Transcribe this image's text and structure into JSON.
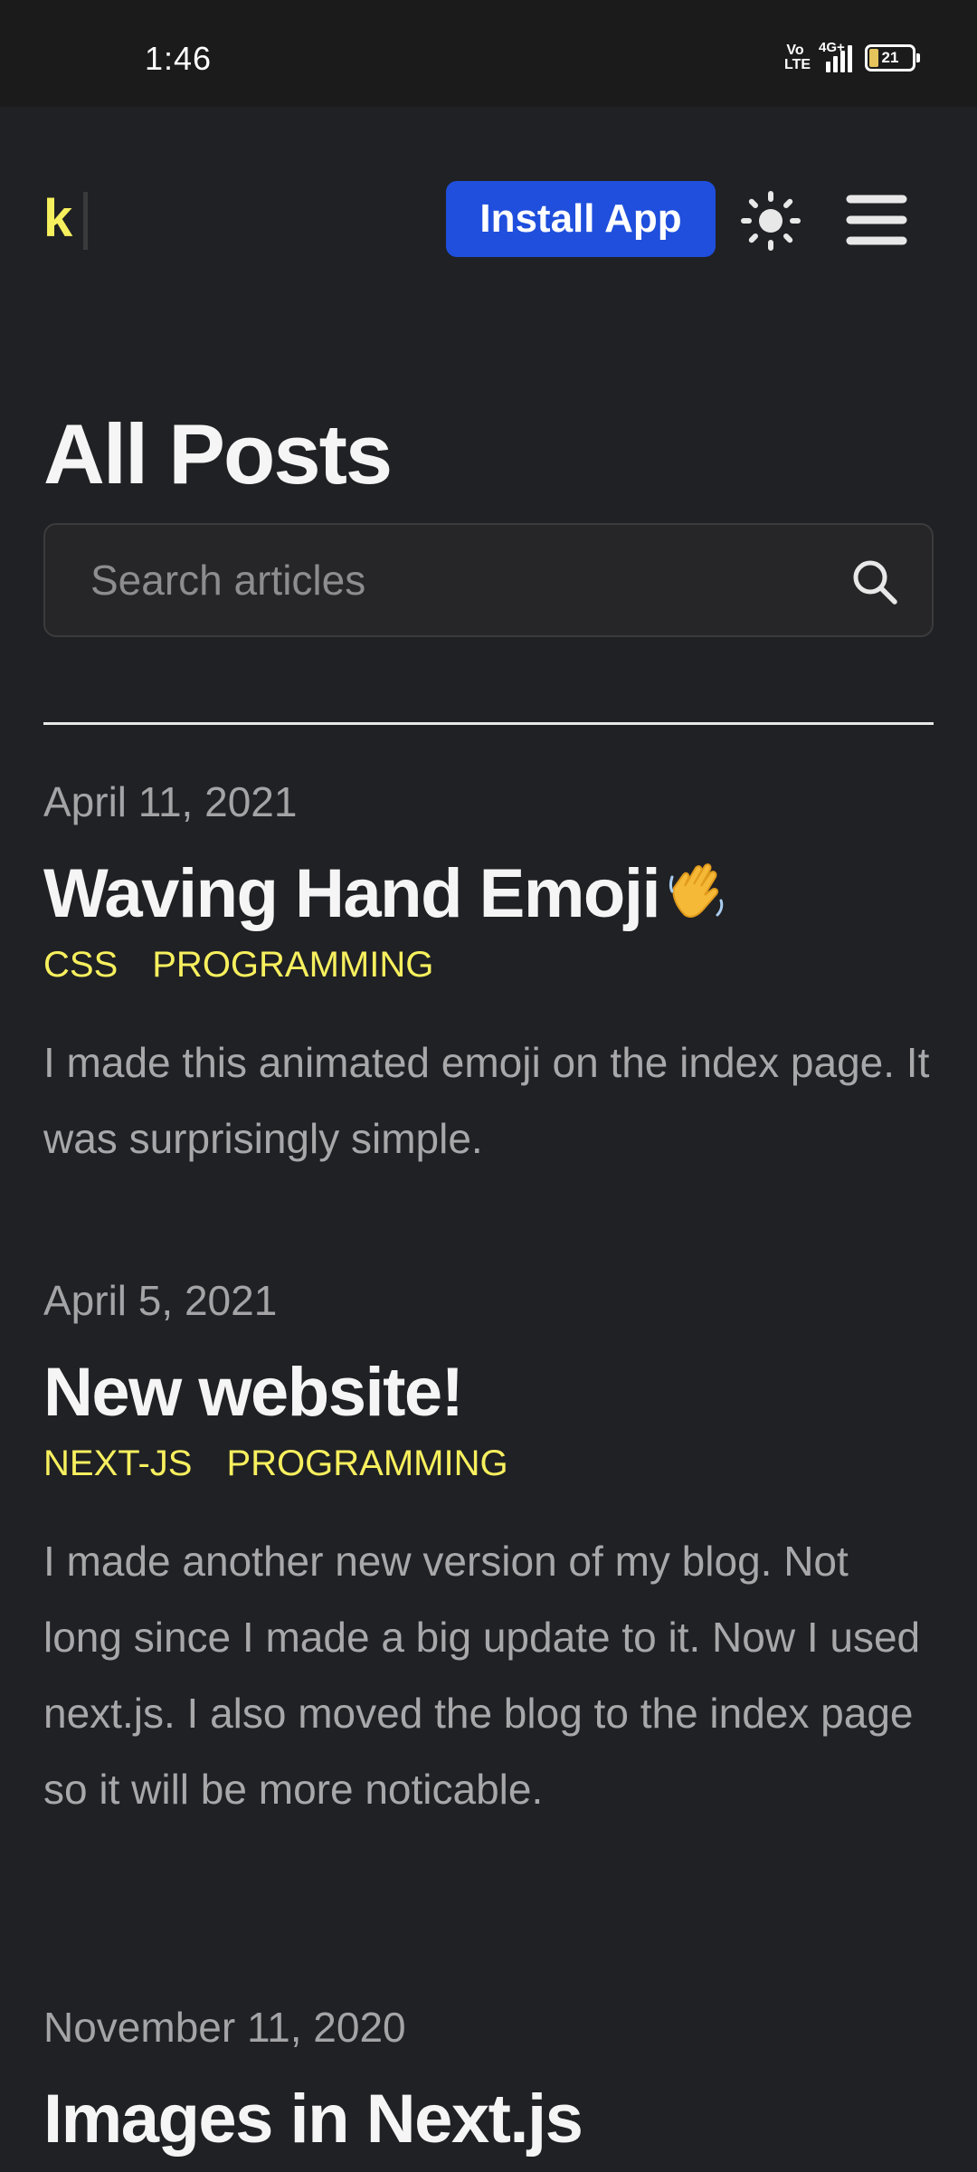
{
  "status_bar": {
    "time": "1:46",
    "volte": "Vo LTE",
    "network": "4G+",
    "battery": "21"
  },
  "header": {
    "logo": "k",
    "install_label": "Install App",
    "theme_icon": "sun-icon",
    "menu_icon": "hamburger-menu-icon"
  },
  "page": {
    "title": "All Posts"
  },
  "search": {
    "placeholder": "Search articles",
    "value": "",
    "icon": "search-icon"
  },
  "posts": [
    {
      "date": "April 11, 2021",
      "title": "Waving Hand Emoji",
      "title_emoji": "waving-hand-icon",
      "tags": [
        "CSS",
        "PROGRAMMING"
      ],
      "summary": "I made this animated emoji on the index page. It was surprisingly simple."
    },
    {
      "date": "April 5, 2021",
      "title": "New website!",
      "tags": [
        "NEXT-JS",
        "PROGRAMMING"
      ],
      "summary": "I made another new version of my blog. Not long since I made a big update to it. Now I used next.js. I also moved the blog to the index page so it will be more noticable."
    },
    {
      "date": "November 11, 2020",
      "title": "Images in Next.js"
    }
  ],
  "colors": {
    "background": "#202124",
    "accent_yellow": "#f7f05e",
    "install_button": "#1f4fdc"
  }
}
